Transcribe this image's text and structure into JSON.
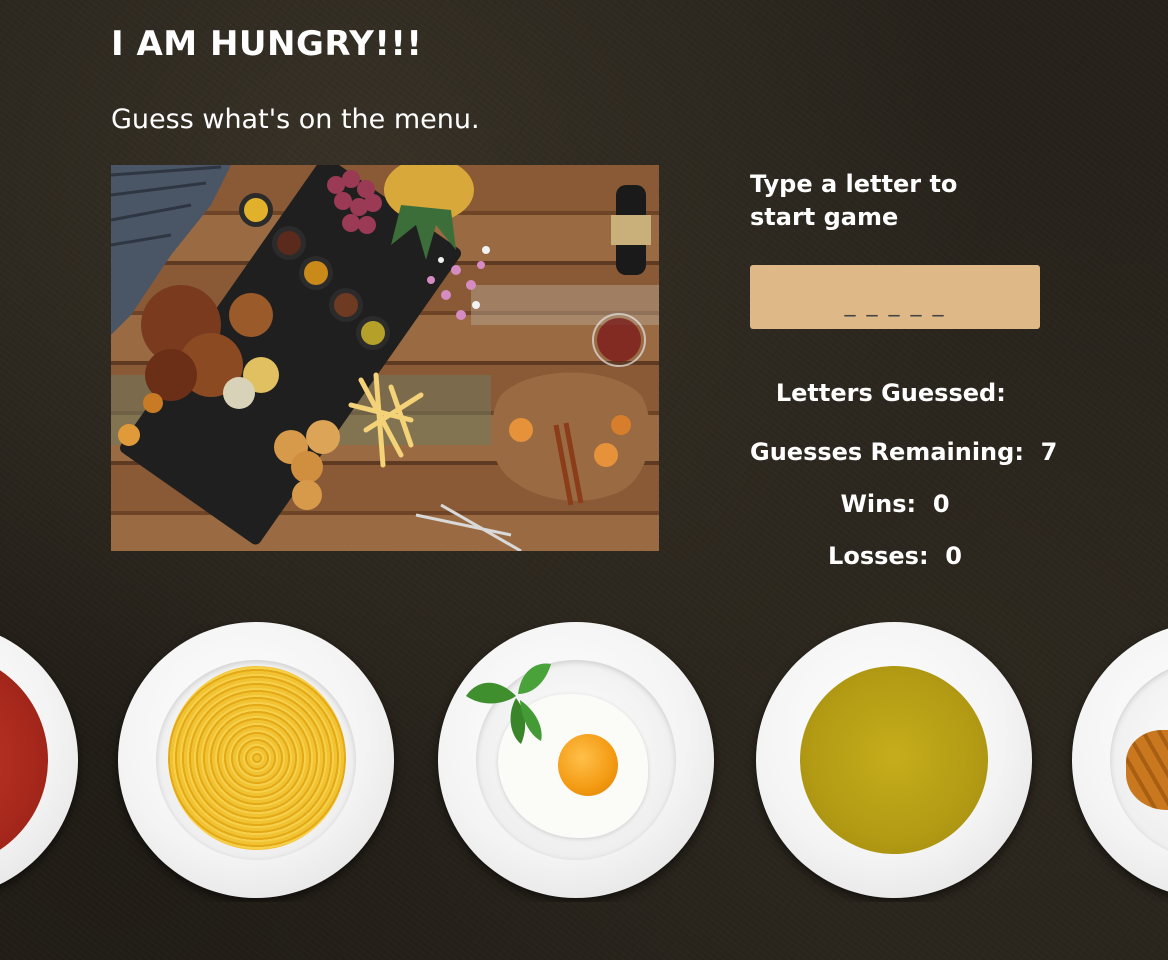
{
  "header": {
    "title": "I AM HUNGRY!!!",
    "subtitle": "Guess what's on the menu."
  },
  "game": {
    "prompt": "Type a letter to start game",
    "word_display": "_ _ _ _ _",
    "letters_guessed_label": "Letters Guessed:",
    "letters_guessed_value": "",
    "guesses_remaining_label": "Guesses Remaining:",
    "guesses_remaining_value": "7",
    "wins_label": "Wins:",
    "wins_value": "0",
    "losses_label": "Losses:",
    "losses_value": "0"
  },
  "colors": {
    "word_box_bg": "#deb887",
    "background": "#26221b",
    "text": "#ffffff"
  },
  "images": {
    "hero": "feast-table-photo",
    "plates": [
      "tomato-soup-plate",
      "spaghetti-plate",
      "fried-egg-plate",
      "pea-soup-plate",
      "croissant-plate"
    ]
  }
}
